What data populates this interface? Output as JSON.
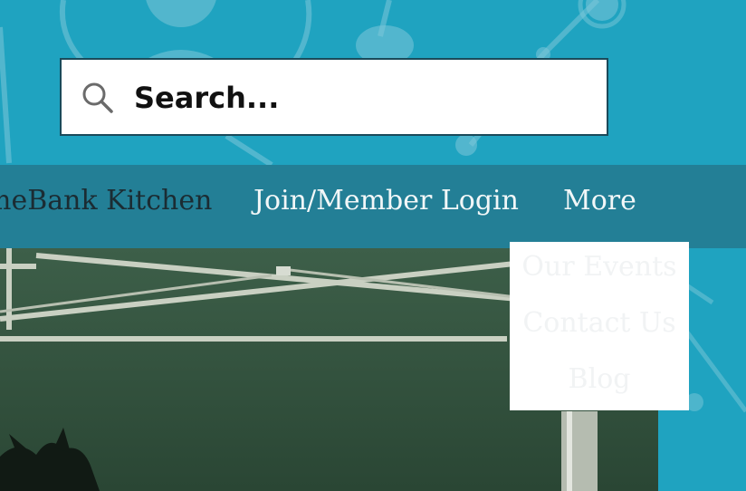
{
  "search": {
    "placeholder": "Search..."
  },
  "nav": {
    "items": [
      {
        "label": "meBank Kitchen"
      },
      {
        "label": "Join/Member Login"
      },
      {
        "label": "More"
      }
    ]
  },
  "dropdown": {
    "items": [
      {
        "label": "Our Events"
      },
      {
        "label": "Contact Us"
      },
      {
        "label": "Blog"
      }
    ]
  },
  "colors": {
    "background": "#1fa3c0",
    "navbar": "#237f96",
    "nav_text_active": "#1b2c33",
    "nav_text": "#f2f7f8",
    "search_border": "#1a4a5a"
  },
  "icons": {
    "search": "search-icon"
  }
}
